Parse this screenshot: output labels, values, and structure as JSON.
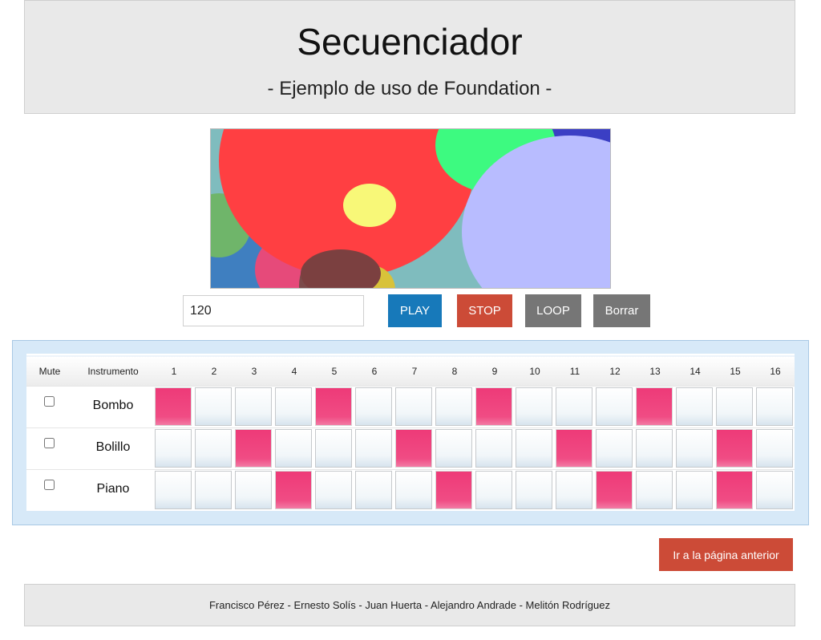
{
  "header": {
    "title": "Secuenciador",
    "subtitle": "- Ejemplo de uso de Foundation -"
  },
  "controls": {
    "tempo_value": "120",
    "play_label": "PLAY",
    "stop_label": "STOP",
    "loop_label": "LOOP",
    "clear_label": "Borrar"
  },
  "colors": {
    "play": "#1779ba",
    "stop": "#cc4b37",
    "secondary": "#767676",
    "step_on": "#ee3a78"
  },
  "grid": {
    "columns": {
      "mute": "Mute",
      "instrument": "Instrumento",
      "steps": [
        "1",
        "2",
        "3",
        "4",
        "5",
        "6",
        "7",
        "8",
        "9",
        "10",
        "11",
        "12",
        "13",
        "14",
        "15",
        "16"
      ]
    },
    "rows": [
      {
        "instrument": "Bombo",
        "muted": false,
        "active_steps": [
          1,
          5,
          9,
          13
        ]
      },
      {
        "instrument": "Bolillo",
        "muted": false,
        "active_steps": [
          3,
          7,
          11,
          15
        ]
      },
      {
        "instrument": "Piano",
        "muted": false,
        "active_steps": [
          4,
          8,
          12,
          15
        ]
      }
    ]
  },
  "back_button": "Ir a la página anterior",
  "footer": {
    "credits": "Francisco Pérez - Ernesto Solís - Juan Huerta - Alejandro Andrade - Melitón Rodríguez"
  }
}
